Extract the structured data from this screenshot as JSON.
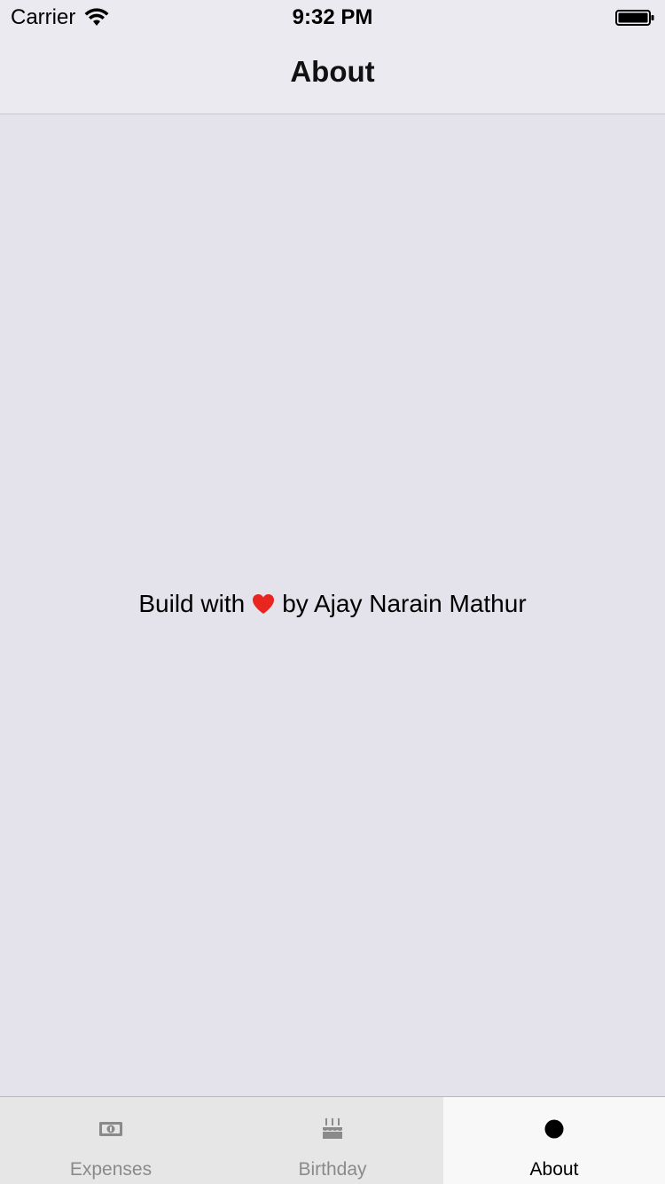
{
  "status_bar": {
    "carrier": "Carrier",
    "time": "9:32 PM"
  },
  "nav": {
    "title": "About"
  },
  "content": {
    "credit_prefix": "Build with",
    "credit_suffix": "by Ajay Narain Mathur",
    "heart_icon": "heart-icon",
    "heart_color": "#e8251f"
  },
  "tabs": [
    {
      "label": "Expenses",
      "icon": "money-icon",
      "active": false
    },
    {
      "label": "Birthday",
      "icon": "cake-icon",
      "active": false
    },
    {
      "label": "About",
      "icon": "dot-icon",
      "active": true
    }
  ]
}
